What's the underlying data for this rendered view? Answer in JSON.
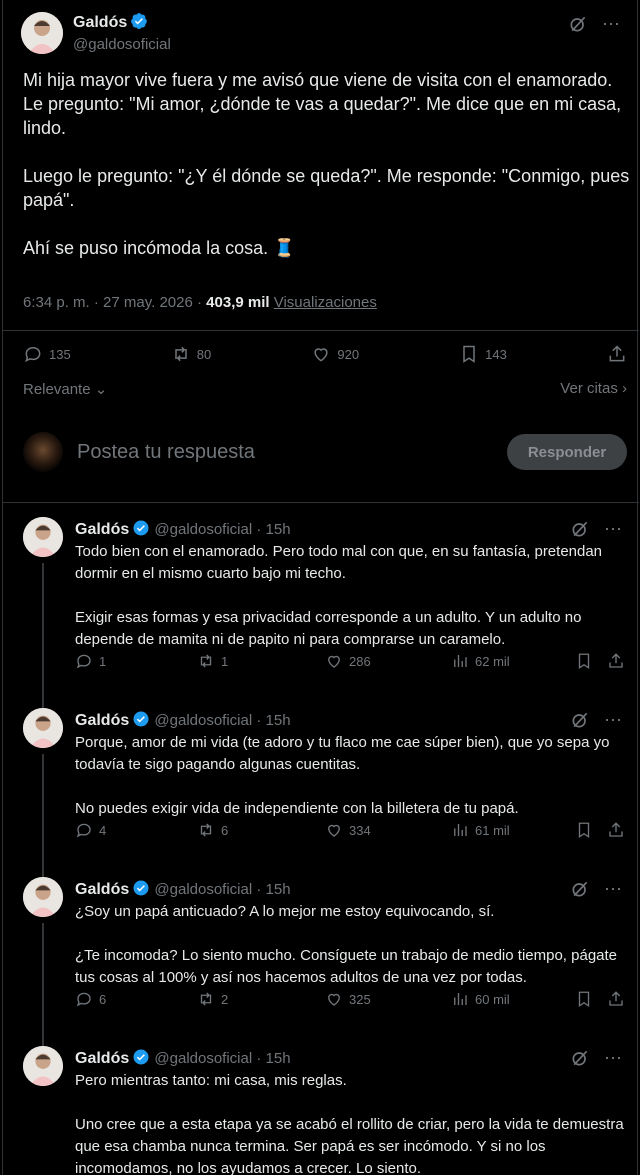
{
  "post": {
    "author_name": "Galdós",
    "author_handle": "@galdosoficial",
    "paragraphs": [
      "Mi hija mayor vive fuera y me avisó que viene de visita con el enamorado. Le pregunto: \"Mi amor, ¿dónde te vas a quedar?\". Me dice que en mi casa, lindo.",
      "Luego le pregunto: \"¿Y él dónde se queda?\". Me responde: \"Conmigo, pues papá\".",
      "Ahí se puso incómoda la cosa. 🧵"
    ],
    "time": "6:34 p. m.",
    "date": "27 may. 2026",
    "views_count": "403,9 mil",
    "views_label": "Visualizaciones",
    "replies": "135",
    "reposts": "80",
    "likes": "920",
    "bookmarks": "143"
  },
  "sort": {
    "label": "Relevante",
    "quotes": "Ver citas"
  },
  "composer": {
    "placeholder": "Postea tu respuesta",
    "button": "Responder"
  },
  "replies": [
    {
      "name": "Galdós",
      "handle": "@galdosoficial",
      "time": "15h",
      "paragraphs": [
        "Todo bien con el enamorado. Pero todo mal con que, en su fantasía, pretendan dormir en el mismo cuarto bajo mi techo.",
        "Exigir esas formas y esa privacidad corresponde a un adulto. Y un adulto no depende de mamita ni de papito ni para comprarse un caramelo."
      ],
      "replies": "1",
      "reposts": "1",
      "likes": "286",
      "views": "62 mil"
    },
    {
      "name": "Galdós",
      "handle": "@galdosoficial",
      "time": "15h",
      "paragraphs": [
        "Porque, amor de mi vida (te adoro y tu flaco me cae súper bien), que yo sepa yo todavía te sigo pagando algunas cuentitas.",
        "No puedes exigir vida de independiente con la billetera de tu papá."
      ],
      "replies": "4",
      "reposts": "6",
      "likes": "334",
      "views": "61 mil"
    },
    {
      "name": "Galdós",
      "handle": "@galdosoficial",
      "time": "15h",
      "paragraphs": [
        "¿Soy un papá anticuado? A lo mejor me estoy equivocando, sí.",
        "¿Te incomoda? Lo siento mucho. Consíguete un trabajo de medio tiempo, págate tus cosas al 100% y así nos hacemos adultos de una vez por todas."
      ],
      "replies": "6",
      "reposts": "2",
      "likes": "325",
      "views": "60 mil"
    },
    {
      "name": "Galdós",
      "handle": "@galdosoficial",
      "time": "15h",
      "paragraphs": [
        "Pero mientras tanto: mi casa, mis reglas.",
        "Uno cree que a esta etapa ya se acabó el rollito de criar, pero la vida te demuestra que esa chamba nunca termina. Ser papá es ser incómodo. Y si no los incomodamos, no los ayudamos a crecer. Lo siento."
      ]
    }
  ],
  "colors": {
    "verified": "#1d9bf0",
    "muted": "#71767b",
    "text": "#e7e9ea",
    "border": "#2f3336"
  },
  "icons": [
    "verified-badge-icon",
    "grok-icon",
    "more-icon",
    "reply-icon",
    "repost-icon",
    "like-icon",
    "views-icon",
    "bookmark-icon",
    "share-icon",
    "chevron-down-icon",
    "chevron-right-icon"
  ]
}
